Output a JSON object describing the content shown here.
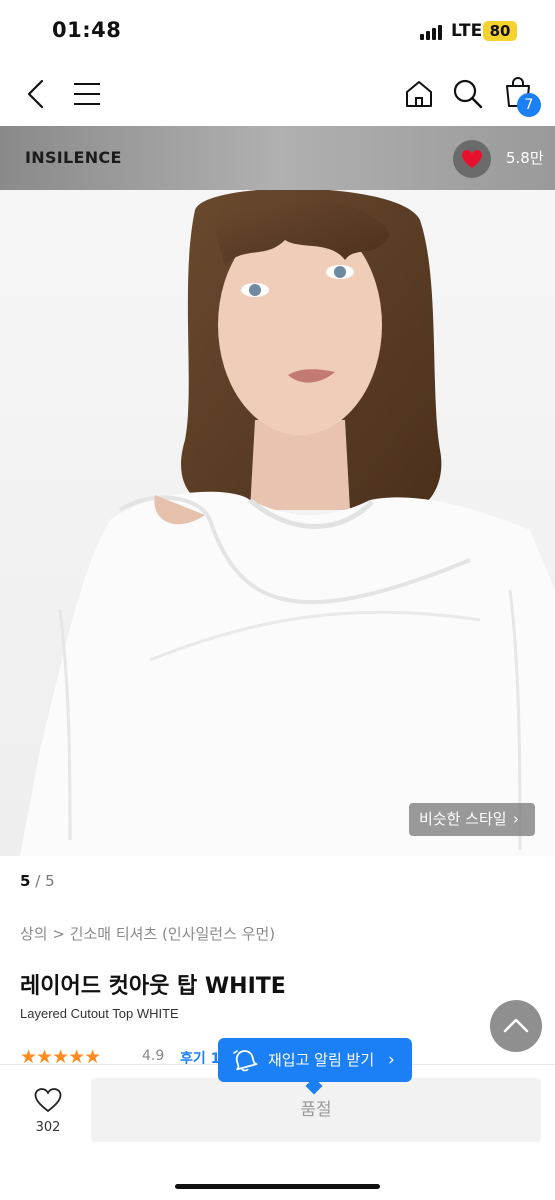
{
  "status_bar": {
    "time": "01:48",
    "network": "LTE",
    "battery": "80"
  },
  "nav": {
    "cart_count": "7"
  },
  "brand": {
    "name": "INSILENCE",
    "like_count": "5.8만"
  },
  "gallery": {
    "current": "5",
    "separator": "/",
    "total": "5",
    "similar_style_label": "비슷한 스타일"
  },
  "product": {
    "breadcrumb": "상의 > 긴소매 티셔츠 (인사일런스 우먼)",
    "title_ko": "레이어드 컷아웃 탑 WHITE",
    "title_en": "Layered Cutout Top WHITE",
    "stars": "★★★★★",
    "rating": "4.9",
    "review_label": "후기 1"
  },
  "restock": {
    "label": "재입고 알림 받기"
  },
  "bottom": {
    "like_count": "302",
    "soldout_label": "품절"
  },
  "colors": {
    "accent": "#1b7ff5",
    "star": "#ff8a1f",
    "heart": "#e8112d"
  }
}
